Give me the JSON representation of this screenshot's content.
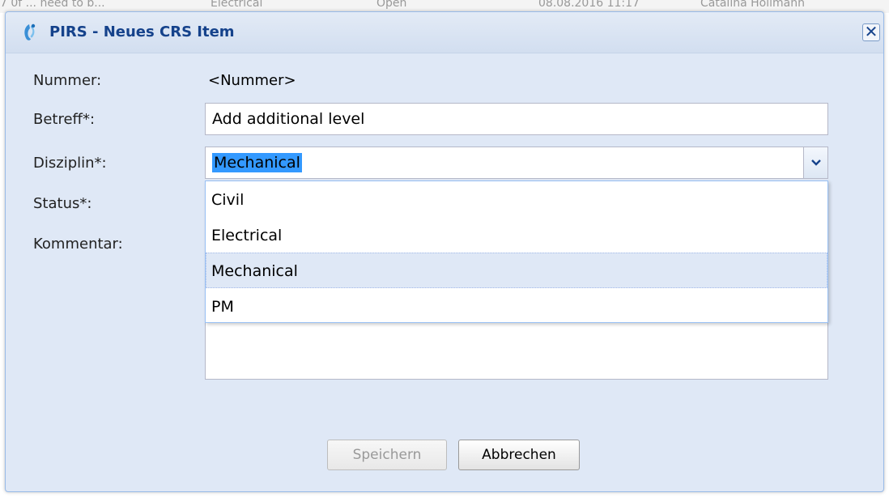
{
  "background_row": {
    "cells": [
      "7 0f ... need to b...",
      "Electrical",
      "Open",
      "08.08.2016 11:17",
      "Catalina Hollmann"
    ]
  },
  "dialog": {
    "title": "PIRS - Neues CRS Item",
    "close_symbol": "✕",
    "icon": "app-logo-icon"
  },
  "form": {
    "nummer_label": "Nummer:",
    "nummer_value": "<Nummer>",
    "betreff_label": "Betreff*:",
    "betreff_value": "Add additional level",
    "disziplin_label": "Disziplin*:",
    "disziplin_value": "Mechanical",
    "status_label": "Status*:",
    "kommentar_label": "Kommentar:"
  },
  "dropdown": {
    "options": [
      "Civil",
      "Electrical",
      "Mechanical",
      "PM"
    ],
    "selected": "Mechanical"
  },
  "buttons": {
    "save_label": "Speichern",
    "cancel_label": "Abbrechen"
  },
  "colors": {
    "title_text": "#15428b",
    "dialog_bg": "#dfe8f6",
    "selection_highlight": "#3399ff"
  }
}
